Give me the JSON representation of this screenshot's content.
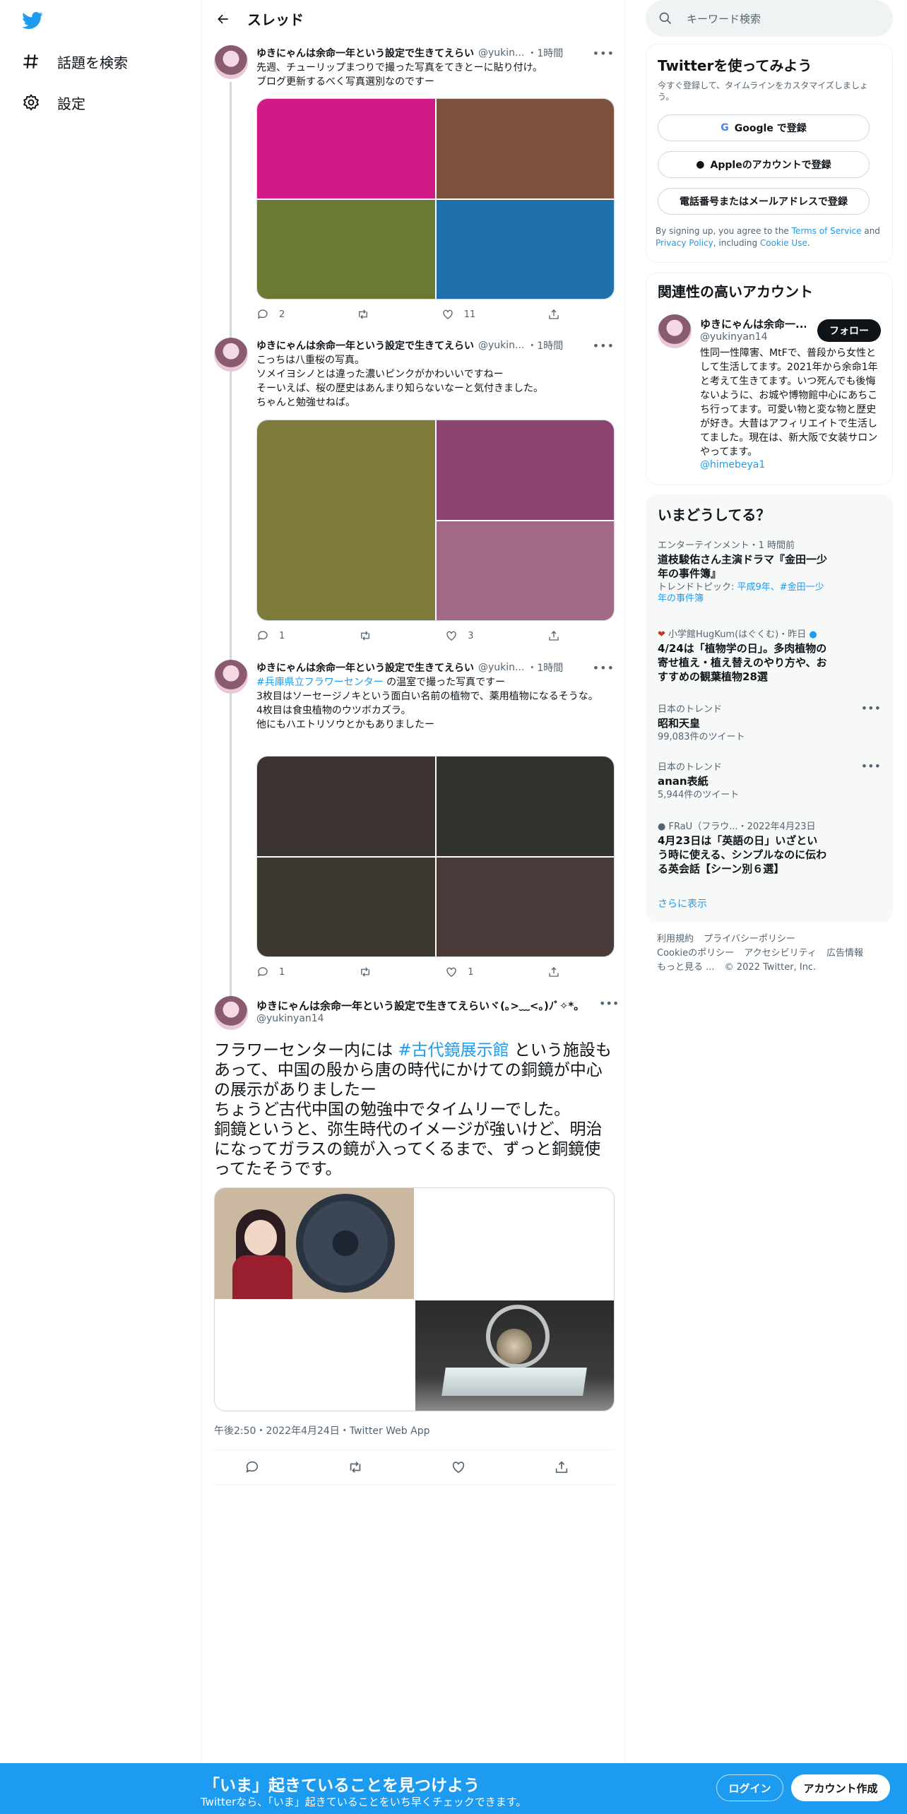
{
  "nav": {
    "items": [
      {
        "label": "話題を検索",
        "icon": "hashtag-icon"
      },
      {
        "label": "設定",
        "icon": "gear-icon"
      }
    ]
  },
  "header": {
    "title": "スレッド"
  },
  "author": {
    "name": "ゆきにゃんは余命一年という設定で生きてえらい",
    "handle": "@yukin...",
    "full_name": "ゆきにゃんは余命一年という設定で生きてえらいヾ(｡>﹏<｡)ﾉﾞ✧*。",
    "full_handle": "@yukinyan14"
  },
  "tweets": [
    {
      "time": "1時間",
      "text": "先週、チューリップまつりで撮った写真をてきとーに貼り付け。\nブログ更新するべく写真選別なのですー",
      "media_colors": [
        "#d21a86",
        "#7d5340",
        "#6b7a33",
        "#1f6fa8"
      ],
      "replies": "2",
      "retweets": "",
      "likes": "11"
    },
    {
      "time": "1時間",
      "text": "こっちは八重桜の写真。\nソメイヨシノとは違った濃いピンクがかわいいですねー\nそーいえば、桜の歴史はあんまり知らないなーと気付きました。\nちゃんと勉強せねば。",
      "media_colors": [
        "#7d7a3a",
        "#8c4571",
        "#a26a86"
      ],
      "replies": "1",
      "retweets": "",
      "likes": "3"
    },
    {
      "time": "1時間",
      "hashtag": "#兵庫県立フラワーセンター",
      "text_after_hashtag": " の温室で撮った写真ですー\n3枚目はソーセージノキという面白い名前の植物で、薬用植物になるそうな。\n4枚目は食虫植物のウツボカズラ。\n他にもハエトリソウとかもありましたー",
      "media_colors": [
        "#3a3330",
        "#32332c",
        "#3d3830",
        "#4a3a3a"
      ],
      "replies": "1",
      "retweets": "",
      "likes": "1"
    }
  ],
  "main_tweet": {
    "text_before": "フラワーセンター内には ",
    "hashtag": "#古代鏡展示館",
    "text_after": " という施設もあって、中国の殷から唐の時代にかけての銅鏡が中心の展示がありましたー\nちょうど古代中国の勉強中でタイムリーでした。\n銅鏡というと、弥生時代のイメージが強いけど、明治になってガラスの鏡が入ってくるまで、ずっと銅鏡使ってたそうです。",
    "meta": "午後2:50・2022年4月24日・Twitter Web App"
  },
  "right": {
    "search_placeholder": "キーワード検索",
    "signup": {
      "title": "Twitterを使ってみよう",
      "subtitle": "今すぐ登録して、タイムラインをカスタマイズしましょう。",
      "google": "Google で登録",
      "apple": "Appleのアカウントで登録",
      "phone": "電話番号またはメールアドレスで登録",
      "legal_1": "By signing up, you agree to the ",
      "tos": "Terms of Service",
      "legal_2": " and ",
      "privacy": "Privacy Policy",
      "legal_3": ", including ",
      "cookie": "Cookie Use",
      "legal_4": "."
    },
    "related": {
      "title": "関連性の高いアカウント",
      "name": "ゆきにゃんは余命一...",
      "handle": "@yukinyan14",
      "follow": "フォロー",
      "bio": "性同一性障害、MtFで、普段から女性として生活してます。2021年から余命1年と考えて生きてます。いつ死んでも後悔ないように、お城や博物館中心にあちこち行ってます。可愛い物と変な物と歴史が好き。大昔はアフィリエイトで生活してました。現在は、新大阪で女装サロン やってます。",
      "link": "@himebeya1"
    },
    "trends": {
      "title": "いまどうしてる？",
      "items": [
        {
          "context": "エンターテインメント・1 時間前",
          "title": "道枝駿佑さん主演ドラマ『金田一少年の事件簿』",
          "sub_prefix": "トレンドトピック: ",
          "sub_links": "平成9年、#金田一少年の事件簿"
        },
        {
          "context": "小学館HugKum(はぐくむ)・昨日",
          "title": "4/24は「植物学の日」。多肉植物の寄せ植え・植え替えのやり方や、おすすめの観葉植物28選"
        },
        {
          "context": "日本のトレンド",
          "title": "昭和天皇",
          "sub": "99,083件のツイート"
        },
        {
          "context": "日本のトレンド",
          "title": "anan表紙",
          "sub": "5,944件のツイート"
        },
        {
          "context": "FRaU（フラウ...・2022年4月23日",
          "title": "4月23日は「英語の日」いざという時に使える、シンプルなのに伝わる英会話【シーン別６選】"
        }
      ],
      "more": "さらに表示"
    },
    "footer": {
      "links": [
        "利用規約",
        "プライバシーポリシー",
        "Cookieのポリシー",
        "アクセシビリティ",
        "広告情報",
        "もっと見る ...",
        "© 2022 Twitter, Inc."
      ]
    }
  },
  "bottom": {
    "headline": "「いま」起きていることを見つけよう",
    "sub": "Twitterなら、「いま」起きていることをいち早くチェックできます。",
    "login": "ログイン",
    "signup": "アカウント作成"
  },
  "colors": {
    "accent": "#1d9bf0",
    "text": "#0f1419",
    "muted": "#536471"
  }
}
